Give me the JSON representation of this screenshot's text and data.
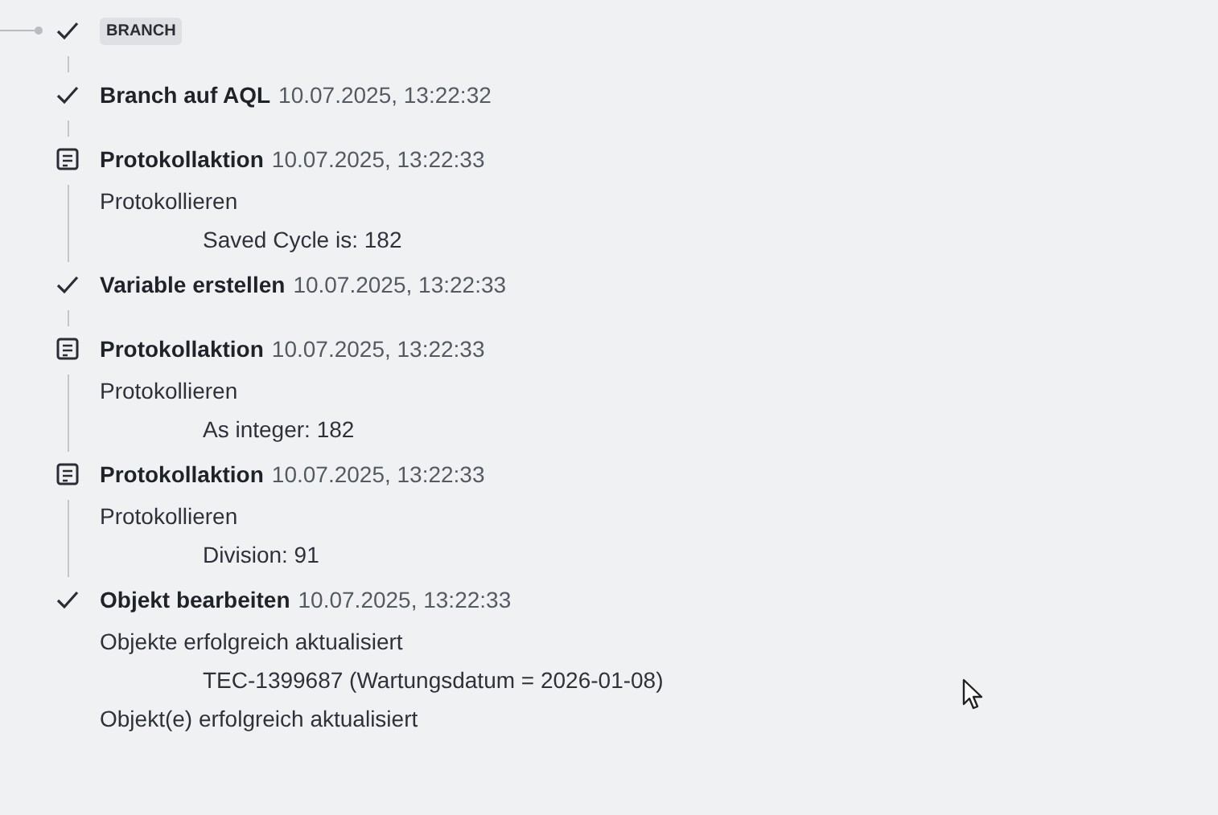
{
  "entries": [
    {
      "kind": "badge",
      "label": "BRANCH"
    },
    {
      "kind": "done",
      "title": "Branch auf AQL",
      "time": "10.07.2025, 13:22:32"
    },
    {
      "kind": "log",
      "title": "Protokollaktion",
      "time": "10.07.2025, 13:22:33",
      "details": [
        {
          "text": "Protokollieren",
          "children": [
            {
              "text": "Saved Cycle is: 182"
            }
          ]
        }
      ]
    },
    {
      "kind": "done",
      "title": "Variable erstellen",
      "time": "10.07.2025, 13:22:33"
    },
    {
      "kind": "log",
      "title": "Protokollaktion",
      "time": "10.07.2025, 13:22:33",
      "details": [
        {
          "text": "Protokollieren",
          "children": [
            {
              "text": "As integer: 182"
            }
          ]
        }
      ]
    },
    {
      "kind": "log",
      "title": "Protokollaktion",
      "time": "10.07.2025, 13:22:33",
      "details": [
        {
          "text": "Protokollieren",
          "children": [
            {
              "text": "Division: 91"
            }
          ]
        }
      ]
    },
    {
      "kind": "done",
      "title": "Objekt bearbeiten",
      "time": "10.07.2025, 13:22:33",
      "details": [
        {
          "text": "Objekte erfolgreich aktualisiert",
          "children": [
            {
              "text": "TEC-1399687 (Wartungsdatum = 2026-01-08)"
            }
          ]
        },
        {
          "text": "Objekt(e) erfolgreich aktualisiert"
        }
      ]
    }
  ]
}
